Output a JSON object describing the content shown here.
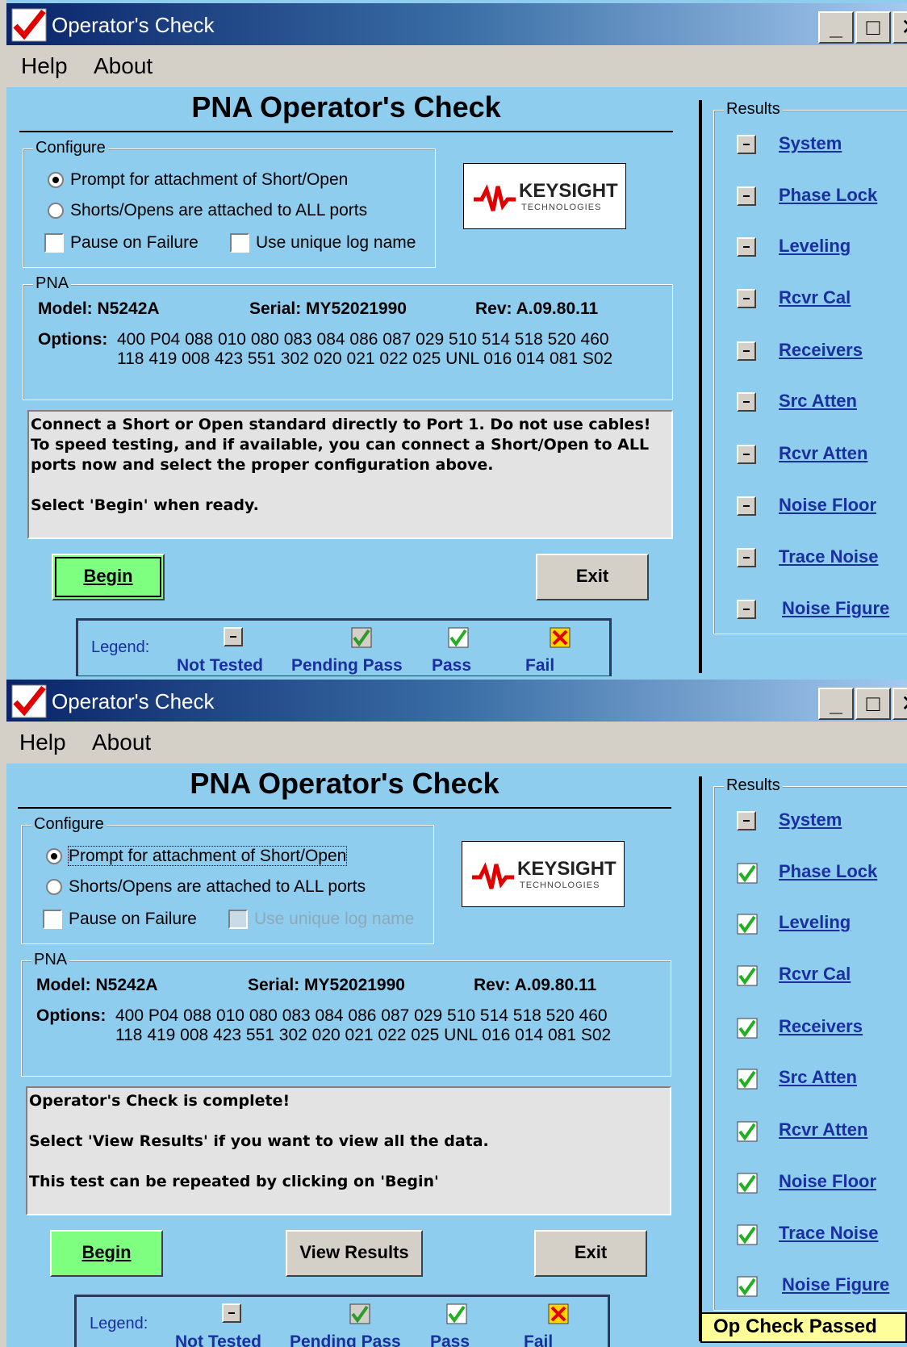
{
  "screens": [
    {
      "window": {
        "title": "Operator's Check"
      },
      "menu": {
        "help": "Help",
        "about": "About"
      },
      "heading": "PNA Operator's Check",
      "configure": {
        "label": "Configure",
        "radio1": "Prompt for attachment of Short/Open",
        "radio2": "Shorts/Opens are attached to ALL ports",
        "pause_on_failure": "Pause on Failure",
        "unique_log_name": "Use unique log name"
      },
      "logo": {
        "brand": "KEYSIGHT",
        "sub": "TECHNOLOGIES"
      },
      "pna": {
        "label": "PNA",
        "model": "Model: N5242A",
        "serial": "Serial: MY52021990",
        "rev": "Rev:  A.09.80.11",
        "options_label": "Options:",
        "options_line1": "400 P04 088 010 080 083 084 086 087 029 510 514 518 520 460",
        "options_line2": "118 419 008 423 551 302 020 021 022 025 UNL 016 014 081 S02"
      },
      "message": [
        "Connect a Short or Open standard directly to Port 1. Do not use cables!",
        "To speed testing, and if available, you can connect a Short/Open to ALL",
        "ports now and select the proper configuration above.",
        "",
        "Select 'Begin' when ready."
      ],
      "buttons": {
        "begin": "Begin",
        "exit": "Exit"
      },
      "legend": {
        "label": "Legend:",
        "not_tested": "Not Tested",
        "pending_pass": "Pending Pass",
        "pass": "Pass",
        "fail": "Fail"
      },
      "results": {
        "label": "Results",
        "items": [
          {
            "name": "System",
            "status": "not-tested"
          },
          {
            "name": "Phase Lock",
            "status": "not-tested"
          },
          {
            "name": "Leveling",
            "status": "not-tested"
          },
          {
            "name": "Rcvr Cal",
            "status": "not-tested"
          },
          {
            "name": "Receivers",
            "status": "not-tested"
          },
          {
            "name": "Src Atten",
            "status": "not-tested"
          },
          {
            "name": "Rcvr Atten",
            "status": "not-tested"
          },
          {
            "name": "Noise Floor",
            "status": "not-tested"
          },
          {
            "name": "Trace Noise",
            "status": "not-tested"
          },
          {
            "name": "Noise Figure",
            "status": "not-tested"
          }
        ]
      }
    },
    {
      "window": {
        "title": "Operator's Check"
      },
      "menu": {
        "help": "Help",
        "about": "About"
      },
      "heading": "PNA Operator's Check",
      "configure": {
        "label": "Configure",
        "radio1": "Prompt for attachment of Short/Open",
        "radio2": "Shorts/Opens are attached to ALL ports",
        "pause_on_failure": "Pause on Failure",
        "unique_log_name": "Use unique log name"
      },
      "logo": {
        "brand": "KEYSIGHT",
        "sub": "TECHNOLOGIES"
      },
      "pna": {
        "label": "PNA",
        "model": "Model: N5242A",
        "serial": "Serial: MY52021990",
        "rev": "Rev:  A.09.80.11",
        "options_label": "Options:",
        "options_line1": "400 P04 088 010 080 083 084 086 087 029 510 514 518 520 460",
        "options_line2": "118 419 008 423 551 302 020 021 022 025 UNL 016 014 081 S02"
      },
      "message": [
        "Operator's Check is complete!",
        "",
        "Select 'View Results' if you want to view all the data.",
        "",
        "This test can be repeated by clicking on 'Begin'"
      ],
      "buttons": {
        "begin": "Begin",
        "view_results": "View Results",
        "exit": "Exit"
      },
      "legend": {
        "label": "Legend:",
        "not_tested": "Not Tested",
        "pending_pass": "Pending Pass",
        "pass": "Pass",
        "fail": "Fail"
      },
      "results": {
        "label": "Results",
        "items": [
          {
            "name": "System",
            "status": "not-tested"
          },
          {
            "name": "Phase Lock",
            "status": "pass"
          },
          {
            "name": "Leveling",
            "status": "pass"
          },
          {
            "name": "Rcvr Cal",
            "status": "pass"
          },
          {
            "name": "Receivers",
            "status": "pass"
          },
          {
            "name": "Src Atten",
            "status": "pass"
          },
          {
            "name": "Rcvr Atten",
            "status": "pass"
          },
          {
            "name": "Noise Floor",
            "status": "pass"
          },
          {
            "name": "Trace Noise",
            "status": "pass"
          },
          {
            "name": "Noise Figure",
            "status": "pass"
          }
        ]
      },
      "status_banner": "Op Check Passed"
    }
  ],
  "colors": {
    "accent_green": "#7fff7f",
    "link_blue": "#1a2fa0",
    "panel_blue": "#8fcdef",
    "banner_yellow": "#ffff99"
  }
}
